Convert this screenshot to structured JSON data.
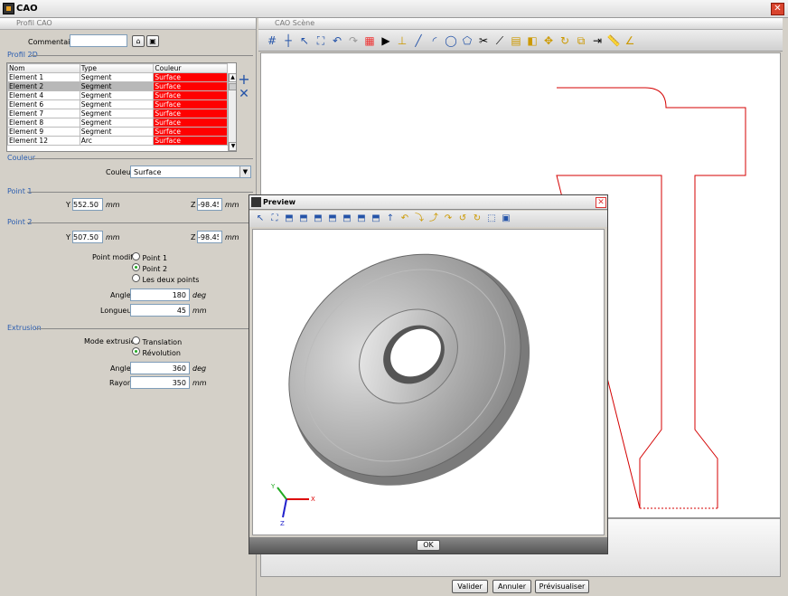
{
  "app": {
    "title": "CAO"
  },
  "left": {
    "header": "Profil CAO",
    "commentaire_label": "Commentaire",
    "commentaire_value": "",
    "profil_title": "Profil 2D",
    "columns": [
      "Nom",
      "Type",
      "Couleur"
    ],
    "rows": [
      [
        "Element 1",
        "Segment",
        "Surface"
      ],
      [
        "Element 2",
        "Segment",
        "Surface"
      ],
      [
        "Element 4",
        "Segment",
        "Surface"
      ],
      [
        "Element 6",
        "Segment",
        "Surface"
      ],
      [
        "Element 7",
        "Segment",
        "Surface"
      ],
      [
        "Element 8",
        "Segment",
        "Surface"
      ],
      [
        "Element 9",
        "Segment",
        "Surface"
      ],
      [
        "Element 12",
        "Arc",
        "Surface"
      ]
    ],
    "couleur_title": "Couleur",
    "couleur_label": "Couleur",
    "couleur_value": "Surface",
    "point1_title": "Point 1",
    "point2_title": "Point 2",
    "y_label": "Y",
    "z_label": "Z",
    "unit_mm": "mm",
    "unit_deg": "deg",
    "p1_y": "552.507",
    "p1_z": "-98.45",
    "p2_y": "507.507",
    "p2_z": "-98.45",
    "point_modifie_label": "Point modifié",
    "point_opts": [
      "Point 1",
      "Point 2",
      "Les deux points"
    ],
    "angle_label": "Angle",
    "angle_value": "180",
    "longueur_label": "Longueur",
    "longueur_value": "45",
    "extrusion_title": "Extrusion",
    "mode_label": "Mode extrusion",
    "mode_opts": [
      "Translation",
      "Révolution"
    ],
    "ext_angle_value": "360",
    "rayon_label": "Rayon",
    "rayon_value": "350"
  },
  "scene": {
    "header": "CAO Scène"
  },
  "preview": {
    "title": "Preview",
    "ok": "OK"
  },
  "buttons": {
    "valider": "Valider",
    "annuler": "Annuler",
    "previsualiser": "Prévisualiser"
  },
  "colors": {
    "profile": "#d40000",
    "accent": "#2a5db0"
  }
}
